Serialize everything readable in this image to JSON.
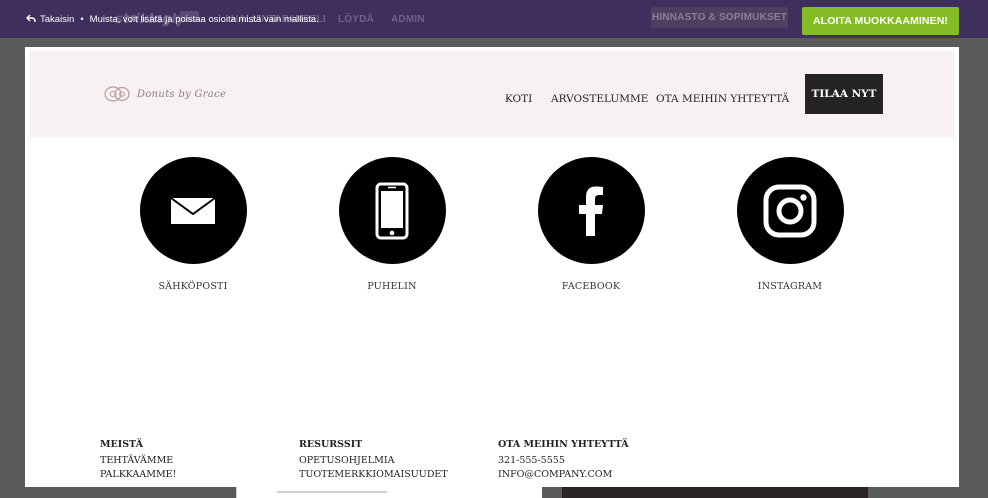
{
  "editor": {
    "logo": "strikingly",
    "nav_ghost": [
      "HALLINTAPANEELI",
      "LÖYDÄ",
      "ADMIN"
    ],
    "back_label": "Takaisin",
    "separator": "•",
    "notice": "Muista, voit lisätä ja poistaa osioita mistä vain mallista.",
    "pricing_label": "HINNASTO & SOPIMUKSET",
    "start_label": "ALOITA MUOKKAAMINEN!",
    "accent_color": "#84bc25",
    "bar_color": "#3e2f5e"
  },
  "site": {
    "brand": "Donuts by Grace",
    "nav": [
      "KOTI",
      "ARVOSTELUMME",
      "OTA MEIHIN YHTEYTTÄ"
    ],
    "order_label": "TILAA NYT",
    "contacts": [
      {
        "label": "SÄHKÖPOSTI",
        "icon": "envelope-icon"
      },
      {
        "label": "PUHELIN",
        "icon": "phone-icon"
      },
      {
        "label": "FACEBOOK",
        "icon": "facebook-icon"
      },
      {
        "label": "INSTAGRAM",
        "icon": "instagram-icon"
      }
    ],
    "footer": [
      {
        "heading": "MEISTÄ",
        "items": [
          "TEHTÄVÄMME",
          "PALKKAAMME!"
        ]
      },
      {
        "heading": "RESURSSIT",
        "items": [
          "OPETUSOHJELMIA",
          "TUOTEMERKKIOMAISUUDET"
        ]
      },
      {
        "heading": "OTA MEIHIN YHTEYTTÄ",
        "items": [
          "321-555-5555",
          "INFO@COMPANY.COM"
        ]
      }
    ]
  }
}
